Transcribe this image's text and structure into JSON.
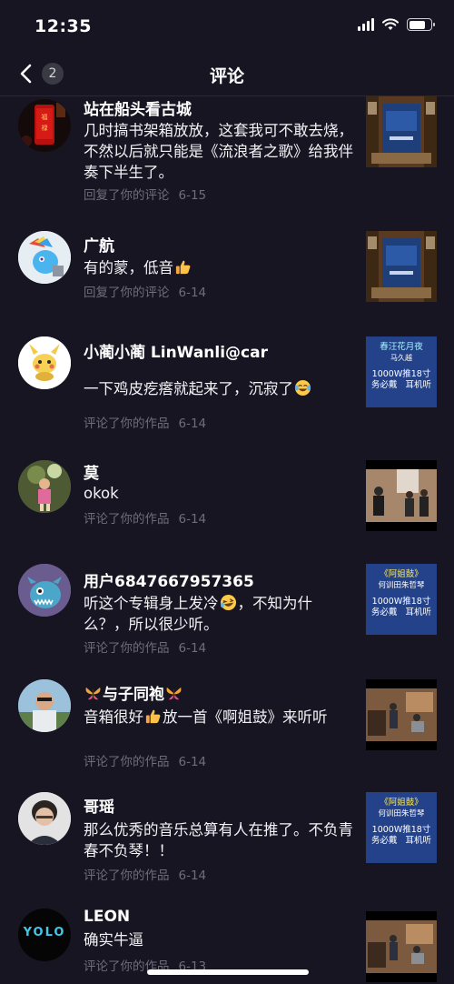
{
  "status_bar": {
    "time": "12:35",
    "battery_level": 0.75
  },
  "nav": {
    "back_count": "2",
    "title": "评论"
  },
  "comments": [
    {
      "username": "站在船头看古城",
      "text": "几时搞书架箱放放，这套我可不敢去烧，不然以后就只能是《流浪者之歌》给我伴奏下半生了。",
      "action": "回复了你的评论",
      "date": "6-15",
      "avatar_icon": "red-lantern-avatar",
      "thumb": "stage-poster"
    },
    {
      "username": "广航",
      "text": "有的蒙，低音",
      "text_suffix_emoji": "thumbs-up",
      "action": "回复了你的评论",
      "date": "6-14",
      "avatar_icon": "pony-avatar",
      "thumb": "stage-poster"
    },
    {
      "username": "小蔺小蔺 LinWanli@car",
      "text": "一下鸡皮疙瘩就起来了，沉寂了",
      "text_suffix_emoji": "tears-of-joy",
      "action": "评论了你的作品",
      "date": "6-14",
      "avatar_icon": "pikachu-avatar",
      "thumb": "poster-1000w",
      "thumb_text": [
        "春汪花月夜",
        "马久越",
        "1000W推18寸",
        "务必戴   耳机听"
      ]
    },
    {
      "username": "莫",
      "text": "okok",
      "action": "评论了你的作品",
      "date": "6-14",
      "avatar_icon": "child-photo-avatar",
      "thumb": "people-video"
    },
    {
      "username": "用户6847667957365",
      "text": "听这个专辑身上发冷",
      "text_emoji": "laughing",
      "text_rest": "，不知为什么？，所以很少听。",
      "action": "评论了你的作品",
      "date": "6-14",
      "avatar_icon": "monster-avatar",
      "thumb": "poster-1000w",
      "thumb_text": [
        "《阿姐鼓》",
        "何训田朱哲琴",
        "1000W推18寸",
        "务必戴   耳机听"
      ]
    },
    {
      "username": "与子同袍",
      "username_emoji": "butterfly",
      "text": "音箱很好",
      "text_emoji": "thumbs-up",
      "text_rest": "放一首《啊姐鼓》来听听",
      "action": "评论了你的作品",
      "date": "6-14",
      "avatar_icon": "man-photo-avatar",
      "thumb": "living-room-video"
    },
    {
      "username": "哥瑶",
      "text": "那么优秀的音乐总算有人在推了。不负青春不负琴！！",
      "action": "评论了你的作品",
      "date": "6-14",
      "avatar_icon": "woman-photo-avatar",
      "thumb": "poster-1000w",
      "thumb_text": [
        "《阿姐鼓》",
        "何训田朱哲琴",
        "1000W推18寸",
        "务必戴   耳机听"
      ]
    },
    {
      "username": "LEON",
      "text": "确实牛逼",
      "action": "评论了你的作品",
      "date": "6-13",
      "avatar_icon": "yolo-avatar",
      "avatar_text": "YOLO",
      "thumb": "living-room-video"
    }
  ]
}
